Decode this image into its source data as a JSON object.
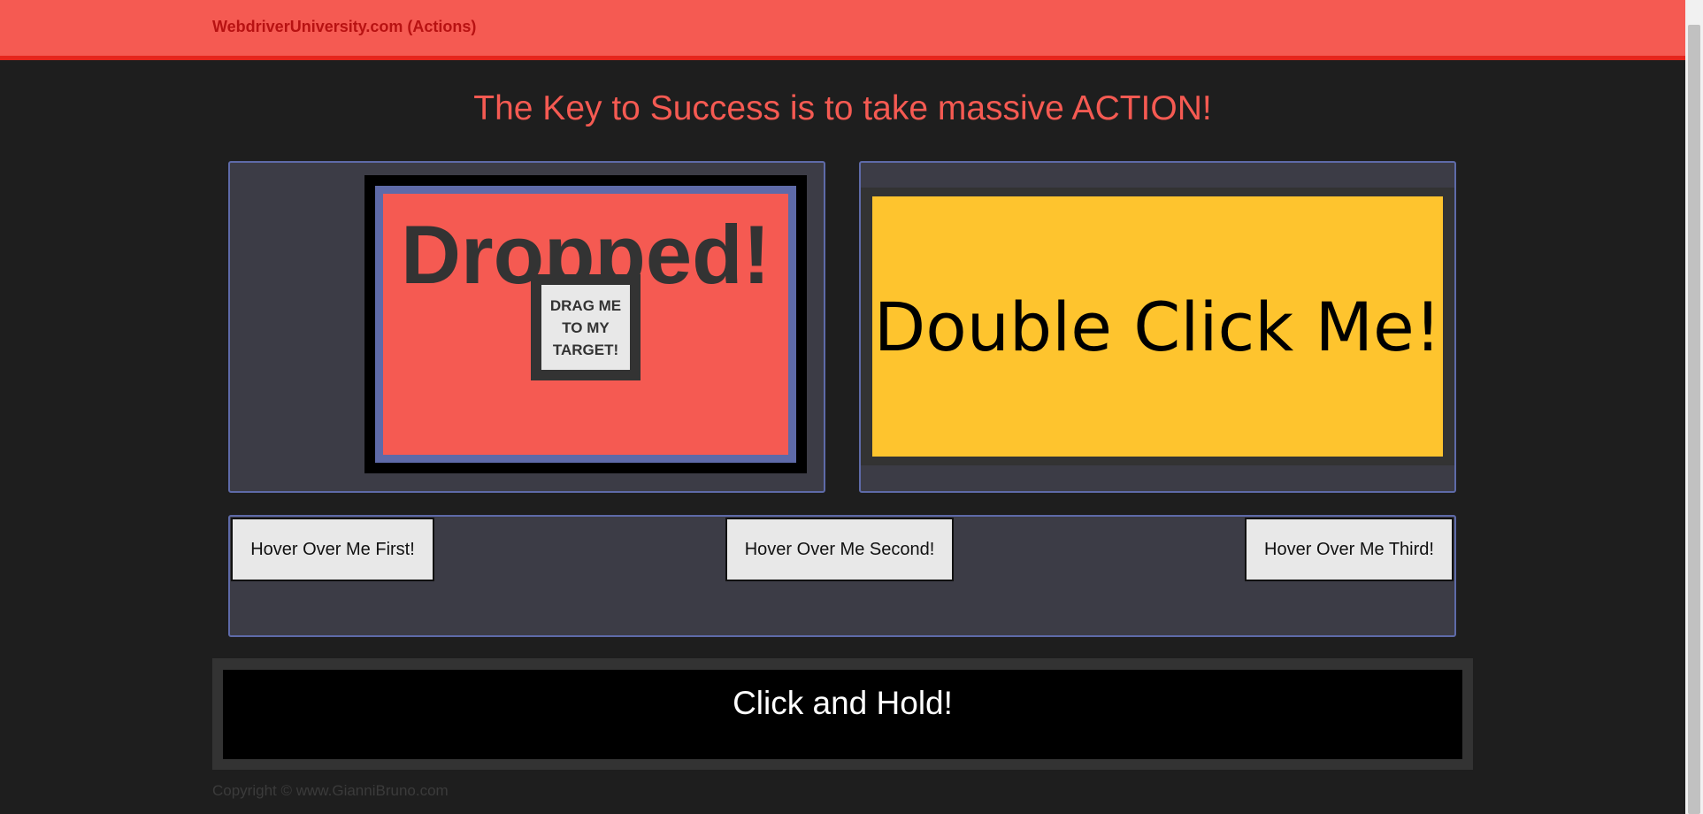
{
  "navbar": {
    "brand": "WebdriverUniversity.com (Actions)"
  },
  "main": {
    "headline": "The Key to Success is to take massive ACTION!",
    "drag_drop": {
      "target_text": "Dropped!",
      "draggable_text": "DRAG ME TO MY TARGET!"
    },
    "double_click": {
      "text": "Double Click Me!"
    },
    "hover_buttons": [
      "Hover Over Me First!",
      "Hover Over Me Second!",
      "Hover Over Me Third!"
    ],
    "click_and_hold": {
      "text": "Click and Hold!"
    }
  },
  "footer": {
    "copyright": "Copyright © www.GianniBruno.com"
  },
  "colors": {
    "navbar": "#f55a52",
    "headline": "#f55a52",
    "panel_bg": "#3c3c46",
    "panel_border": "#5e6aa8",
    "double_click_bg": "#fec42e",
    "page_bg": "#1e1e1e"
  }
}
